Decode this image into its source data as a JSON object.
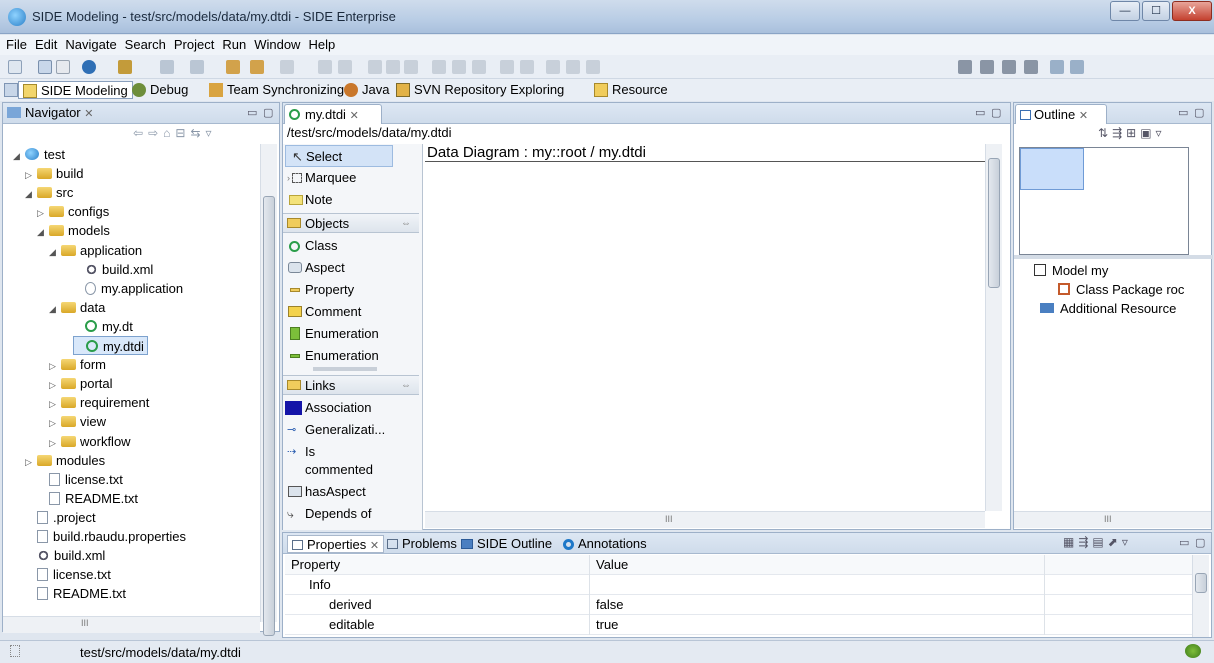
{
  "window": {
    "title": "SIDE Modeling - test/src/models/data/my.dtdi - SIDE Enterprise",
    "min": "—",
    "max": "☐",
    "close": "X"
  },
  "menu": [
    "File",
    "Edit",
    "Navigate",
    "Search",
    "Project",
    "Run",
    "Window",
    "Help"
  ],
  "perspectives": [
    {
      "label": "SIDE Modeling",
      "active": true
    },
    {
      "label": "Debug"
    },
    {
      "label": "Team Synchronizing"
    },
    {
      "label": "Java"
    },
    {
      "label": "SVN Repository Exploring"
    },
    {
      "label": "Resource"
    }
  ],
  "navigator": {
    "tab": "Navigator",
    "items": [
      {
        "label": "test",
        "kind": "project",
        "indent": 0,
        "expander": "open"
      },
      {
        "label": "build",
        "kind": "folder",
        "indent": 1,
        "expander": "closed"
      },
      {
        "label": "src",
        "kind": "folder",
        "indent": 1,
        "expander": "open"
      },
      {
        "label": "configs",
        "kind": "folder",
        "indent": 2,
        "expander": "closed"
      },
      {
        "label": "models",
        "kind": "folder",
        "indent": 2,
        "expander": "open"
      },
      {
        "label": "application",
        "kind": "folder",
        "indent": 3,
        "expander": "open"
      },
      {
        "label": "build.xml",
        "kind": "xml",
        "indent": 5,
        "expander": ""
      },
      {
        "label": "my.application",
        "kind": "app",
        "indent": 5,
        "expander": ""
      },
      {
        "label": "data",
        "kind": "folder",
        "indent": 3,
        "expander": "open"
      },
      {
        "label": "my.dt",
        "kind": "dt",
        "indent": 5,
        "expander": ""
      },
      {
        "label": "my.dtdi",
        "kind": "dt",
        "indent": 5,
        "expander": "",
        "selected": true
      },
      {
        "label": "form",
        "kind": "folder",
        "indent": 3,
        "expander": "closed"
      },
      {
        "label": "portal",
        "kind": "folder",
        "indent": 3,
        "expander": "closed"
      },
      {
        "label": "requirement",
        "kind": "folder",
        "indent": 3,
        "expander": "closed"
      },
      {
        "label": "view",
        "kind": "folder",
        "indent": 3,
        "expander": "closed"
      },
      {
        "label": "workflow",
        "kind": "folder",
        "indent": 3,
        "expander": "closed"
      },
      {
        "label": "modules",
        "kind": "folder",
        "indent": 1,
        "expander": "closed"
      },
      {
        "label": "license.txt",
        "kind": "file",
        "indent": 2,
        "expander": ""
      },
      {
        "label": "README.txt",
        "kind": "file",
        "indent": 2,
        "expander": ""
      },
      {
        "label": ".project",
        "kind": "file",
        "indent": 1,
        "expander": ""
      },
      {
        "label": "build.rbaudu.properties",
        "kind": "file",
        "indent": 1,
        "expander": ""
      },
      {
        "label": "build.xml",
        "kind": "xml",
        "indent": 1,
        "expander": ""
      },
      {
        "label": "license.txt",
        "kind": "file",
        "indent": 1,
        "expander": ""
      },
      {
        "label": "README.txt",
        "kind": "file",
        "indent": 1,
        "expander": ""
      }
    ]
  },
  "editor": {
    "tab": "my.dtdi",
    "path": "/test/src/models/data/my.dtdi",
    "diagram_title": "Data Diagram : my::root / my.dtdi",
    "palette": {
      "tools": [
        "Select",
        "Marquee",
        "Note"
      ],
      "objects_header": "Objects",
      "objects": [
        "Class",
        "Aspect",
        "Property",
        "Comment",
        "Enumeration",
        "Enumeration"
      ],
      "links_header": "Links",
      "links": [
        "Association",
        "Generalizati...",
        "Is",
        "commented",
        "hasAspect",
        "Depends of"
      ]
    }
  },
  "outline": {
    "tab": "Outline",
    "items": [
      "Model my",
      "Class Package roc",
      "Additional Resource"
    ]
  },
  "bottom": {
    "tabs": [
      "Properties",
      "Problems",
      "SIDE Outline",
      "Annotations"
    ],
    "columns": [
      "Property",
      "Value"
    ],
    "rows": [
      {
        "property": "Info",
        "value": ""
      },
      {
        "property": "derived",
        "value": "false"
      },
      {
        "property": "editable",
        "value": "true"
      }
    ]
  },
  "status": {
    "path": "test/src/models/data/my.dtdi"
  },
  "scroll_glyph": "III"
}
